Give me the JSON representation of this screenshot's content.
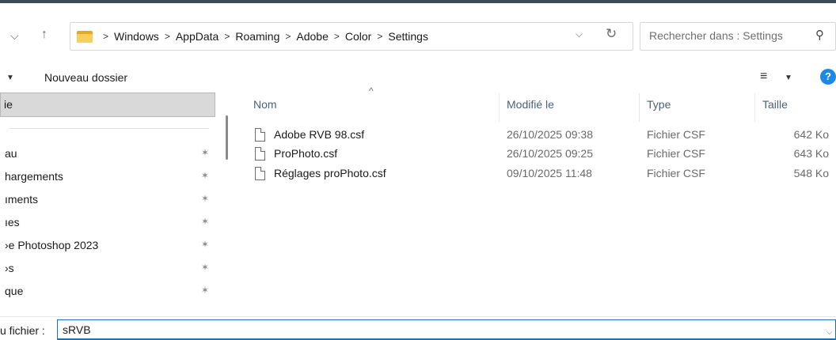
{
  "address_bar": {
    "segments": [
      "Windows",
      "AppData",
      "Roaming",
      "Adobe",
      "Color",
      "Settings"
    ],
    "separator": ">",
    "dropdown_glyph": "⌵",
    "refresh_glyph": "↻",
    "folder_icon": "folder-icon"
  },
  "nav_buttons": {
    "recent_glyph": "⌵",
    "up_glyph": "↑"
  },
  "search": {
    "placeholder": "Rechercher dans : Settings",
    "icon_glyph": "⚲"
  },
  "toolbar": {
    "organize_dropdown_glyph": "▼",
    "new_folder": "Nouveau dossier",
    "view_glyph": "≡",
    "view_dropdown_glyph": "▼",
    "help_glyph": "?"
  },
  "nav_pane": {
    "selected": "ie",
    "items": [
      {
        "label": "au"
      },
      {
        "label": "hargements"
      },
      {
        "label": "ıments"
      },
      {
        "label": "ıes"
      },
      {
        "label": "›e Photoshop 2023"
      },
      {
        "label": "›s"
      },
      {
        "label": "que"
      }
    ],
    "pin_glyph": "📌"
  },
  "columns": {
    "sort_glyph": "^",
    "name": "Nom",
    "modified": "Modifié le",
    "type": "Type",
    "size": "Taille"
  },
  "files": [
    {
      "name": "Adobe RVB 98.csf",
      "modified": "26/10/2025 09:38",
      "type": "Fichier CSF",
      "size": "642 Ko"
    },
    {
      "name": "ProPhoto.csf",
      "modified": "26/10/2025 09:25",
      "type": "Fichier CSF",
      "size": "643 Ko"
    },
    {
      "name": "Réglages proPhoto.csf",
      "modified": "09/10/2025 11:48",
      "type": "Fichier CSF",
      "size": "548 Ko"
    }
  ],
  "filename": {
    "label": "u fichier :",
    "value": "sRVB",
    "dropdown_glyph": "⌵"
  },
  "colors": {
    "accent": "#1f6fb5",
    "folder": "#f8cf5a",
    "help": "#1e88e5"
  }
}
